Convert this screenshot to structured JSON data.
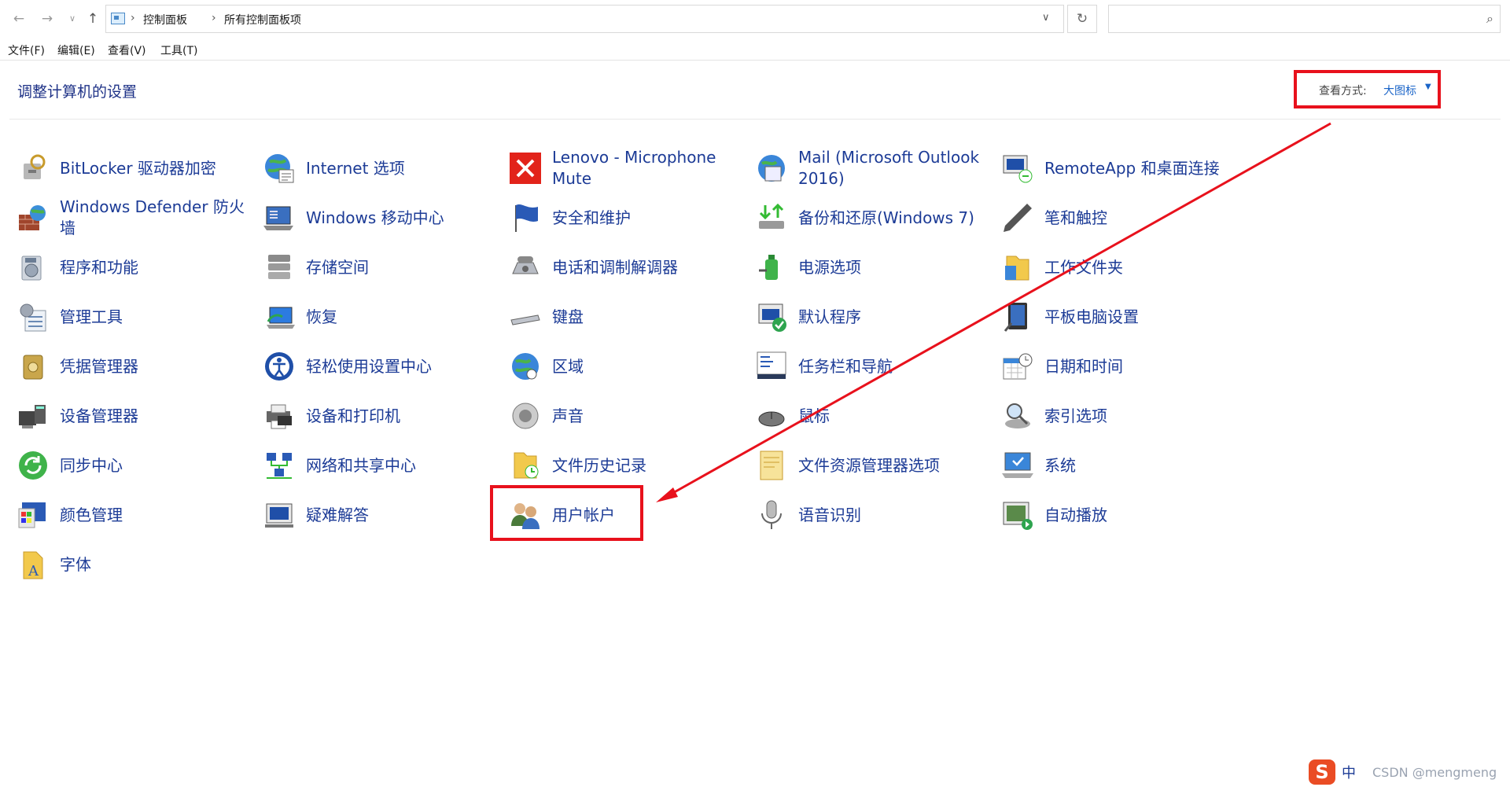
{
  "address_bar": {
    "back_icon": "back-arrow-icon",
    "forward_icon": "forward-arrow-icon",
    "breadcrumb": [
      "控制面板",
      "所有控制面板项"
    ],
    "search_placeholder": ""
  },
  "menu": [
    "文件(F)",
    "编辑(E)",
    "查看(V)",
    "工具(T)"
  ],
  "header": {
    "title": "调整计算机的设置",
    "view_by_label": "查看方式:",
    "view_by_value": "大图标"
  },
  "items": [
    [
      "BitLocker 驱动器加密",
      "Windows Defender 防火墙",
      "程序和功能",
      "管理工具",
      "凭据管理器",
      "设备管理器",
      "同步中心",
      "颜色管理",
      "字体"
    ],
    [
      "Internet 选项",
      "Windows 移动中心",
      "存储空间",
      "恢复",
      "轻松使用设置中心",
      "设备和打印机",
      "网络和共享中心",
      "疑难解答"
    ],
    [
      "Lenovo - Microphone Mute",
      "安全和维护",
      "电话和调制解调器",
      "键盘",
      "区域",
      "声音",
      "文件历史记录",
      "用户帐户"
    ],
    [
      "Mail (Microsoft Outlook 2016)",
      "备份和还原(Windows 7)",
      "电源选项",
      "默认程序",
      "任务栏和导航",
      "鼠标",
      "文件资源管理器选项",
      "语音识别"
    ],
    [
      "RemoteApp 和桌面连接",
      "笔和触控",
      "工作文件夹",
      "平板电脑设置",
      "日期和时间",
      "索引选项",
      "系统",
      "自动播放"
    ]
  ],
  "tray": {
    "ime_label": "中",
    "watermark": "CSDN @mengmeng"
  },
  "colors": {
    "link": "#1c3b96",
    "highlight": "#e8111c"
  }
}
